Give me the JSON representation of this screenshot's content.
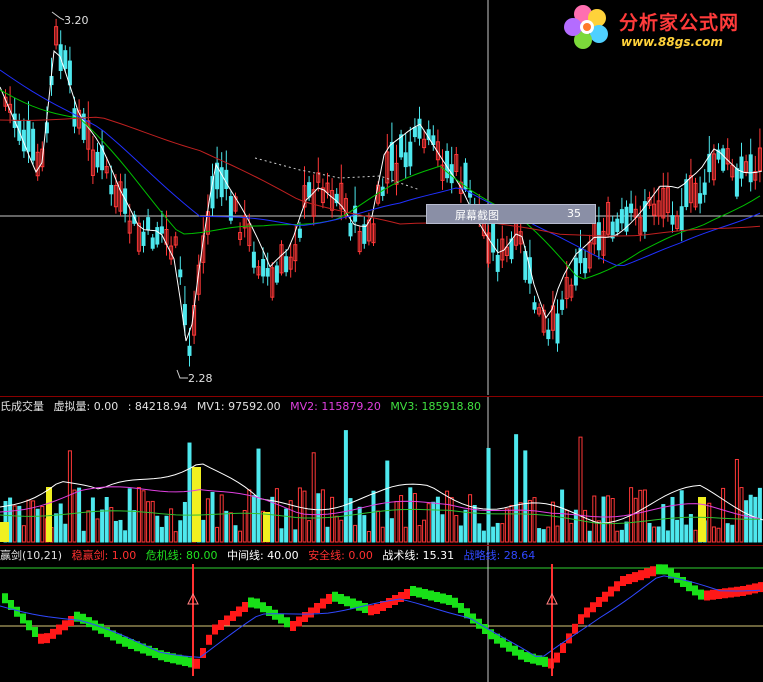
{
  "logo": {
    "title": "分析家公式网",
    "url": "www.88gs.com"
  },
  "price_panel": {
    "high_marker": "3.20",
    "low_marker": "2.28",
    "tooltip_label": "屏幕截图",
    "tooltip_value": "35"
  },
  "volume_panel": {
    "title": "氏成交量",
    "virtual_label": "虚拟量: 0.00",
    "vol_label": ": 84218.94",
    "mv1": "MV1: 97592.00",
    "mv2": "MV2: 115879.20",
    "mv3": "MV3: 185918.80"
  },
  "indicator_panel": {
    "title": "赢剑(10,21)",
    "items": [
      {
        "label": "稳赢剑: 1.00",
        "color": "#ff3030"
      },
      {
        "label": "危机线: 80.00",
        "color": "#20e020"
      },
      {
        "label": "中间线: 40.00",
        "color": "#ffffff"
      },
      {
        "label": "安全线: 0.00",
        "color": "#ff3030"
      },
      {
        "label": "战术线: 15.31",
        "color": "#ffffff"
      },
      {
        "label": "战略线: 28.64",
        "color": "#3048ff"
      }
    ]
  },
  "colors": {
    "up": "#ff3838",
    "down": "#4ee8ee",
    "ma_white": "#ffffff",
    "ma_green": "#00c000",
    "ma_blue": "#2030ff",
    "ma_red": "#c02020"
  }
}
